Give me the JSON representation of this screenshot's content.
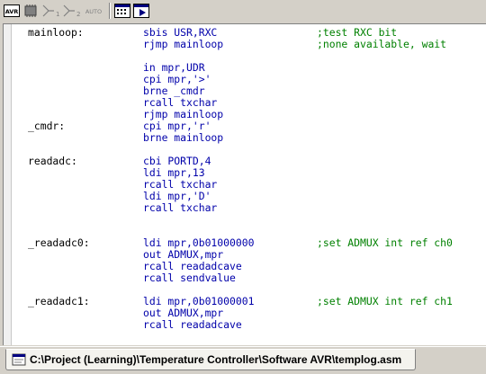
{
  "toolbar": {
    "buttons": [
      {
        "name": "avr-build-icon",
        "label": "AVR"
      },
      {
        "name": "chip-icon",
        "label": ""
      },
      {
        "name": "debug-step-1-icon",
        "label": "1"
      },
      {
        "name": "debug-step-2-icon",
        "label": "2"
      },
      {
        "name": "auto-icon",
        "label": "AUTO"
      },
      {
        "name": "memory-window-icon",
        "label": ""
      },
      {
        "name": "run-icon",
        "label": ""
      }
    ]
  },
  "editor": {
    "lines": [
      {
        "label": "mainloop:",
        "instr": "sbis USR,RXC",
        "comment": ";test RXC bit"
      },
      {
        "label": "",
        "instr": "rjmp mainloop",
        "comment": ";none available, wait"
      },
      {
        "label": "",
        "instr": "",
        "comment": ""
      },
      {
        "label": "",
        "instr": "in mpr,UDR",
        "comment": ""
      },
      {
        "label": "",
        "instr": "cpi mpr,'>'",
        "comment": ""
      },
      {
        "label": "",
        "instr": "brne _cmdr",
        "comment": ""
      },
      {
        "label": "",
        "instr": "rcall txchar",
        "comment": ""
      },
      {
        "label": "",
        "instr": "rjmp mainloop",
        "comment": ""
      },
      {
        "label": "_cmdr:",
        "instr": "cpi mpr,'r'",
        "comment": ""
      },
      {
        "label": "",
        "instr": "brne mainloop",
        "comment": ""
      },
      {
        "label": "",
        "instr": "",
        "comment": ""
      },
      {
        "label": "readadc:",
        "instr": "cbi PORTD,4",
        "comment": ""
      },
      {
        "label": "",
        "instr": "ldi mpr,13",
        "comment": ""
      },
      {
        "label": "",
        "instr": "rcall txchar",
        "comment": ""
      },
      {
        "label": "",
        "instr": "ldi mpr,'D'",
        "comment": ""
      },
      {
        "label": "",
        "instr": "rcall txchar",
        "comment": ""
      },
      {
        "label": "",
        "instr": "",
        "comment": ""
      },
      {
        "label": "",
        "instr": "",
        "comment": ""
      },
      {
        "label": "_readadc0:",
        "instr": "ldi mpr,0b01000000",
        "comment": ";set ADMUX int ref ch0"
      },
      {
        "label": "",
        "instr": "out ADMUX,mpr",
        "comment": ""
      },
      {
        "label": "",
        "instr": "rcall readadcave",
        "comment": ""
      },
      {
        "label": "",
        "instr": "rcall sendvalue",
        "comment": ""
      },
      {
        "label": "",
        "instr": "",
        "comment": ""
      },
      {
        "label": "_readadc1:",
        "instr": "ldi mpr,0b01000001",
        "comment": ";set ADMUX int ref ch1"
      },
      {
        "label": "",
        "instr": "out ADMUX,mpr",
        "comment": ""
      },
      {
        "label": "",
        "instr": "rcall readadcave",
        "comment": ""
      },
      {
        "label": "",
        "instr": "",
        "comment": ""
      }
    ]
  },
  "file_tab": {
    "path": "C:\\Project (Learning)\\Temperature Controller\\Software AVR\\templog.asm"
  },
  "colors": {
    "instruction": "#0000aa",
    "comment": "#008000",
    "label": "#000000"
  }
}
